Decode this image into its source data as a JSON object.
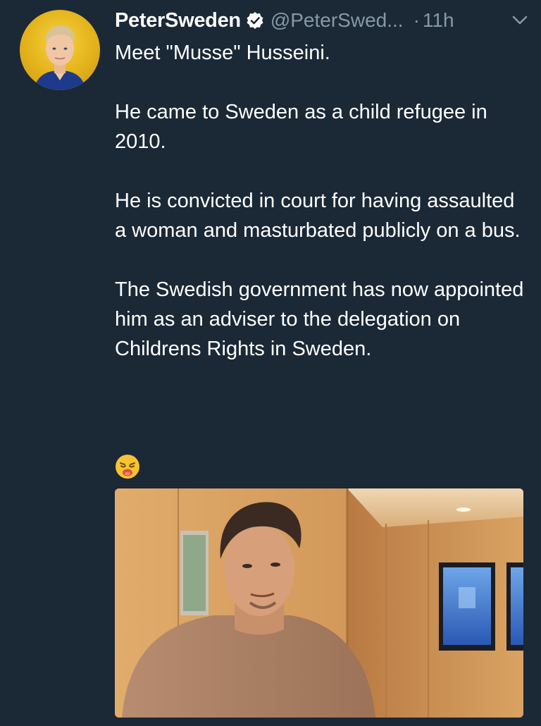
{
  "tweet": {
    "display_name": "PeterSweden",
    "handle": "@PeterSwed...",
    "separator": "·",
    "time": "11h",
    "paragraphs": [
      "Meet \"Musse\" Husseini.",
      "He came to Sweden as a child refugee in 2010.",
      "He is convicted in court for having assaulted a woman and masturbated publicly on a bus.",
      "The Swedish government has now appointed him as an adviser to the delegation on Childrens Rights in Sweden."
    ],
    "emoji": "weary-face-icon",
    "verified_icon": "verified-badge-icon",
    "menu_icon": "chevron-down-icon"
  },
  "colors": {
    "background": "#1b2836",
    "text": "#ffffff",
    "secondary_text": "#8899a6",
    "avatar_ring": "#e3b21b"
  }
}
